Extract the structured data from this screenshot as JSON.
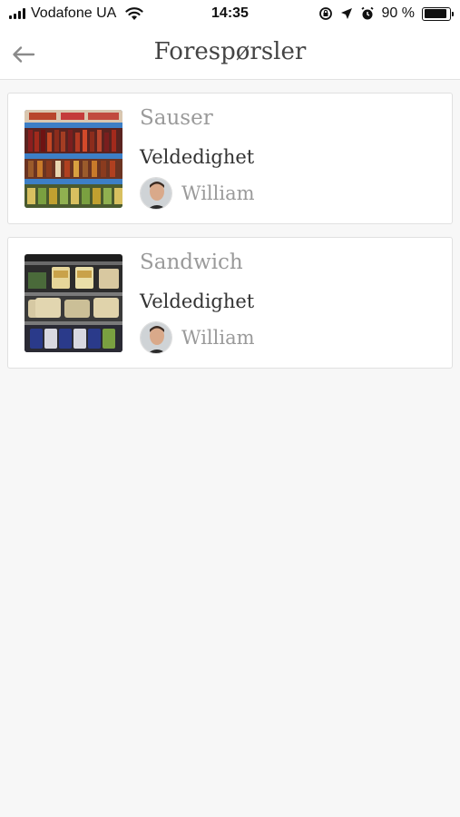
{
  "status_bar": {
    "carrier": "Vodafone UA",
    "time": "14:35",
    "battery": "90 %",
    "battery_level": 0.9
  },
  "header": {
    "title": "Forespørsler",
    "back_icon": "arrow-left-icon"
  },
  "requests": [
    {
      "title": "Sauser",
      "category": "Veldedighet",
      "user": "William",
      "image": "supermarket-shelf-sauces"
    },
    {
      "title": "Sandwich",
      "category": "Veldedighet",
      "user": "William",
      "image": "sandwich-display-case"
    }
  ]
}
